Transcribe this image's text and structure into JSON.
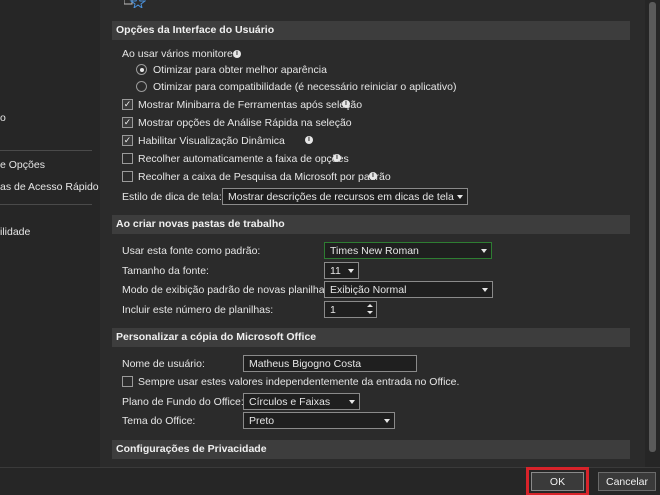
{
  "sidebar": {
    "items": [
      {
        "label": "o"
      },
      {
        "label": "e Opções"
      },
      {
        "label": "as de Acesso Rápido"
      },
      {
        "label": "ilidade"
      }
    ]
  },
  "sections": {
    "ui_options": {
      "header": "Opções da Interface do Usuário",
      "multi_monitor_label": "Ao usar vários monitores:",
      "radio_best_appearance": "Otimizar para obter melhor aparência",
      "radio_compatibility": "Otimizar para compatibilidade (é necessário reiniciar o aplicativo)",
      "chk_minibar": "Mostrar Minibarra de Ferramentas após seleção",
      "chk_quick_analysis": "Mostrar opções de Análise Rápida na seleção",
      "chk_live_preview": "Habilitar Visualização Dinâmica",
      "chk_collapse_ribbon": "Recolher automaticamente a faixa de opções",
      "chk_collapse_search": "Recolher a caixa de Pesquisa da Microsoft por padrão",
      "tooltip_style_label": "Estilo de dica de tela:",
      "tooltip_style_value": "Mostrar descrições de recursos em dicas de tela"
    },
    "new_workbooks": {
      "header": "Ao criar novas pastas de trabalho",
      "font_label": "Usar esta fonte como padrão:",
      "font_value": "Times New Roman",
      "size_label": "Tamanho da fonte:",
      "size_value": "11",
      "view_label": "Modo de exibição padrão de novas planilhas:",
      "view_value": "Exibição Normal",
      "sheets_label": "Incluir este número de planilhas:",
      "sheets_value": "1"
    },
    "personalize": {
      "header": "Personalizar a cópia do Microsoft Office",
      "username_label": "Nome de usuário:",
      "username_value": "Matheus Bigogno Costa",
      "always_use_label": "Sempre usar estes valores independentemente da entrada no Office.",
      "background_label": "Plano de Fundo do Office:",
      "background_value": "Círculos e Faixas",
      "theme_label": "Tema do Office:",
      "theme_value": "Preto"
    },
    "privacy": {
      "header": "Configurações de Privacidade"
    }
  },
  "footer": {
    "ok_label": "OK",
    "cancel_label": "Cancelar"
  },
  "colors": {
    "highlight": "#d8232a"
  }
}
